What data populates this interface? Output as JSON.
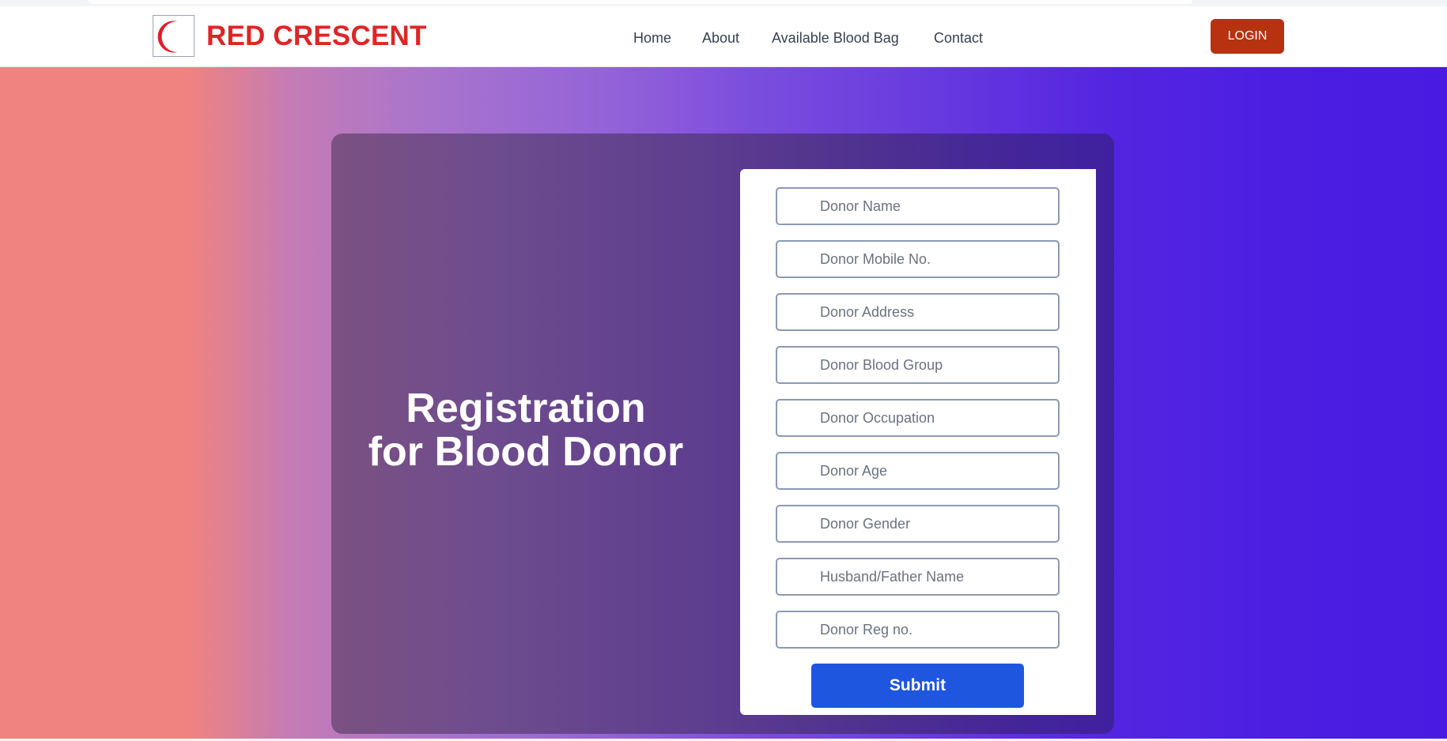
{
  "brand": {
    "name": "RED CRESCENT",
    "logo_icon": "crescent-icon",
    "accent_color": "#dc2626"
  },
  "nav": {
    "links": [
      {
        "label": "Home"
      },
      {
        "label": "About"
      },
      {
        "label": "Available Blood Bag"
      },
      {
        "label": "Contact"
      }
    ],
    "login_label": "LOGIN"
  },
  "hero": {
    "title_line1": "Registration",
    "title_line2": "for Blood Donor"
  },
  "form": {
    "fields": [
      {
        "placeholder": "Donor Name",
        "value": ""
      },
      {
        "placeholder": "Donor Mobile No.",
        "value": ""
      },
      {
        "placeholder": "Donor Address",
        "value": ""
      },
      {
        "placeholder": "Donor Blood Group",
        "value": ""
      },
      {
        "placeholder": "Donor Occupation",
        "value": ""
      },
      {
        "placeholder": "Donor Age",
        "value": ""
      },
      {
        "placeholder": "Donor Gender",
        "value": ""
      },
      {
        "placeholder": "Husband/Father Name",
        "value": ""
      },
      {
        "placeholder": "Donor Reg no.",
        "value": ""
      }
    ],
    "submit_label": "Submit",
    "submit_color": "#1e56e0"
  },
  "colors": {
    "login_button": "#b7320f"
  }
}
